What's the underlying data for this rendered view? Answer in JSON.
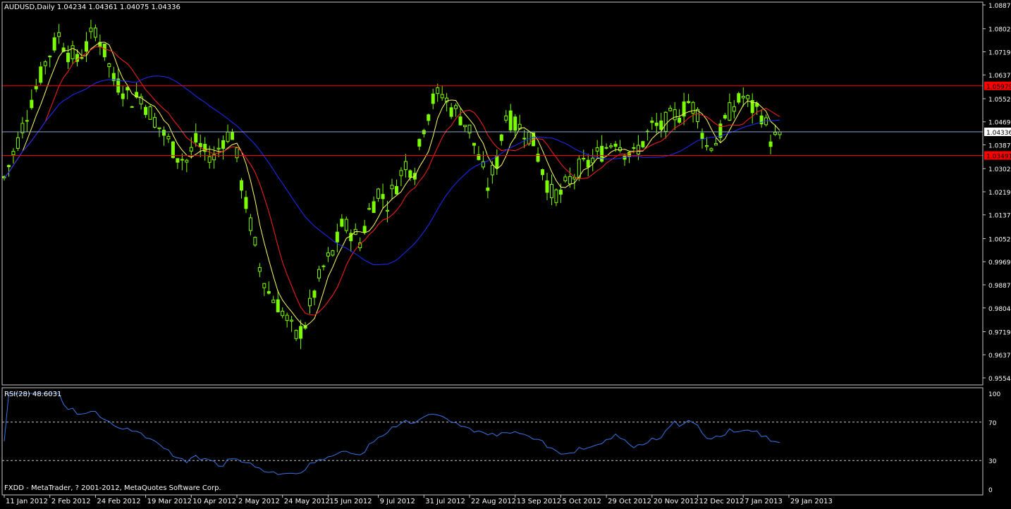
{
  "chart_title": "AUDUSD,Daily  1.04234 1.04361 1.04075 1.04336",
  "footer": "FXDD - MetaTrader, ? 2001-2012, MetaQuotes Software Corp.",
  "colors": {
    "background": "#000000",
    "frame": "#c8c8c8",
    "candle": "#7cfc00",
    "ma_fast": "#ffff66",
    "ma_mid": "#ff2020",
    "ma_slow": "#1e2cff",
    "hline_red": "#ff0000",
    "hline_gray": "#8fa8c8",
    "rsi_line": "#3a74e8",
    "price_label_bg": "#ff0000",
    "text": "#ffffff"
  },
  "chart_data": {
    "type": "line",
    "title": "AUDUSD,Daily",
    "instrument": "AUDUSD",
    "timeframe": "Daily",
    "ohlc_last": {
      "open": 1.04234,
      "high": 1.04361,
      "low": 1.04075,
      "close": 1.04336
    },
    "price_axis_ticks": [
      "1.08870",
      "1.08020",
      "1.07195",
      "1.06370",
      "1.05520",
      "1.04695",
      "1.03870",
      "1.03020",
      "1.02195",
      "1.01370",
      "1.00520",
      "0.99695",
      "0.98870",
      "0.98045",
      "0.97195",
      "0.96370",
      "0.95545"
    ],
    "ylim": [
      0.95545,
      1.0887
    ],
    "time_axis_labels": [
      "11 Jan 2012",
      "2 Feb 2012",
      "24 Feb 2012",
      "19 Mar 2012",
      "10 Apr 2012",
      "2 May 2012",
      "24 May 2012",
      "15 Jun 2012",
      "9 Jul 2012",
      "31 Jul 2012",
      "22 Aug 2012",
      "13 Sep 2012",
      "5 Oct 2012",
      "29 Oct 2012",
      "20 Nov 2012",
      "12 Dec 2012",
      "7 Jan 2013",
      "29 Jan 2013"
    ],
    "price_series": [
      {
        "t": 0,
        "v": 1.027
      },
      {
        "t": 3,
        "v": 1.04
      },
      {
        "t": 6,
        "v": 1.055
      },
      {
        "t": 9,
        "v": 1.068
      },
      {
        "t": 12,
        "v": 1.078
      },
      {
        "t": 14,
        "v": 1.072
      },
      {
        "t": 16,
        "v": 1.069
      },
      {
        "t": 18,
        "v": 1.074
      },
      {
        "t": 20,
        "v": 1.08
      },
      {
        "t": 22,
        "v": 1.072
      },
      {
        "t": 24,
        "v": 1.062
      },
      {
        "t": 26,
        "v": 1.059
      },
      {
        "t": 28,
        "v": 1.055
      },
      {
        "t": 30,
        "v": 1.056
      },
      {
        "t": 32,
        "v": 1.05
      },
      {
        "t": 34,
        "v": 1.045
      },
      {
        "t": 36,
        "v": 1.04
      },
      {
        "t": 38,
        "v": 1.035
      },
      {
        "t": 40,
        "v": 1.033
      },
      {
        "t": 42,
        "v": 1.04
      },
      {
        "t": 44,
        "v": 1.036
      },
      {
        "t": 46,
        "v": 1.034
      },
      {
        "t": 48,
        "v": 1.041
      },
      {
        "t": 50,
        "v": 1.043
      },
      {
        "t": 52,
        "v": 1.025
      },
      {
        "t": 54,
        "v": 1.01
      },
      {
        "t": 56,
        "v": 0.995
      },
      {
        "t": 58,
        "v": 0.986
      },
      {
        "t": 60,
        "v": 0.982
      },
      {
        "t": 62,
        "v": 0.976
      },
      {
        "t": 64,
        "v": 0.97
      },
      {
        "t": 66,
        "v": 0.975
      },
      {
        "t": 68,
        "v": 0.986
      },
      {
        "t": 70,
        "v": 0.995
      },
      {
        "t": 72,
        "v": 1.0
      },
      {
        "t": 74,
        "v": 1.01
      },
      {
        "t": 76,
        "v": 1.008
      },
      {
        "t": 78,
        "v": 1.004
      },
      {
        "t": 80,
        "v": 1.015
      },
      {
        "t": 82,
        "v": 1.022
      },
      {
        "t": 84,
        "v": 1.018
      },
      {
        "t": 86,
        "v": 1.025
      },
      {
        "t": 88,
        "v": 1.032
      },
      {
        "t": 90,
        "v": 1.03
      },
      {
        "t": 92,
        "v": 1.046
      },
      {
        "t": 94,
        "v": 1.055
      },
      {
        "t": 96,
        "v": 1.057
      },
      {
        "t": 98,
        "v": 1.052
      },
      {
        "t": 100,
        "v": 1.049
      },
      {
        "t": 102,
        "v": 1.044
      },
      {
        "t": 104,
        "v": 1.034
      },
      {
        "t": 106,
        "v": 1.024
      },
      {
        "t": 108,
        "v": 1.033
      },
      {
        "t": 110,
        "v": 1.05
      },
      {
        "t": 112,
        "v": 1.046
      },
      {
        "t": 114,
        "v": 1.044
      },
      {
        "t": 116,
        "v": 1.04
      },
      {
        "t": 118,
        "v": 1.03
      },
      {
        "t": 120,
        "v": 1.021
      },
      {
        "t": 122,
        "v": 1.021
      },
      {
        "t": 124,
        "v": 1.026
      },
      {
        "t": 126,
        "v": 1.03
      },
      {
        "t": 128,
        "v": 1.032
      },
      {
        "t": 130,
        "v": 1.035
      },
      {
        "t": 132,
        "v": 1.038
      },
      {
        "t": 134,
        "v": 1.041
      },
      {
        "t": 136,
        "v": 1.037
      },
      {
        "t": 138,
        "v": 1.035
      },
      {
        "t": 140,
        "v": 1.04
      },
      {
        "t": 142,
        "v": 1.045
      },
      {
        "t": 144,
        "v": 1.045
      },
      {
        "t": 146,
        "v": 1.048
      },
      {
        "t": 148,
        "v": 1.05
      },
      {
        "t": 150,
        "v": 1.054
      },
      {
        "t": 152,
        "v": 1.05
      },
      {
        "t": 154,
        "v": 1.038
      },
      {
        "t": 156,
        "v": 1.04
      },
      {
        "t": 158,
        "v": 1.047
      },
      {
        "t": 160,
        "v": 1.053
      },
      {
        "t": 162,
        "v": 1.056
      },
      {
        "t": 164,
        "v": 1.052
      },
      {
        "t": 166,
        "v": 1.05
      },
      {
        "t": 168,
        "v": 1.041
      },
      {
        "t": 170,
        "v": 1.041
      }
    ],
    "series": [
      {
        "name": "fast MA"
      },
      {
        "name": "mid MA"
      },
      {
        "name": "slow MA"
      }
    ],
    "horizontal_lines": [
      {
        "value": 1.05979,
        "label": "1.05979",
        "style": "red"
      },
      {
        "value": 1.04336,
        "label": "1.04336",
        "style": "gray"
      },
      {
        "value": 1.03491,
        "label": "1.03491",
        "style": "red"
      }
    ],
    "rsi": {
      "label": "RSI(28) 48.6031",
      "period": 28,
      "last": 48.6031,
      "axis_ticks": [
        "100",
        "70",
        "30",
        "0"
      ],
      "levels": [
        70,
        30
      ],
      "ylim": [
        0,
        100
      ]
    }
  }
}
